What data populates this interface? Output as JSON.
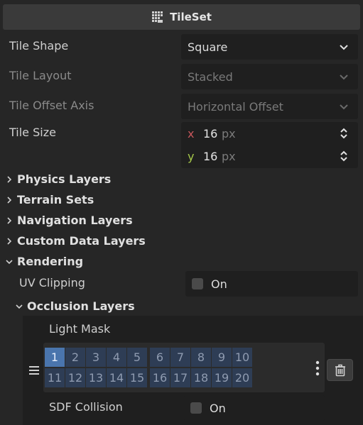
{
  "header": {
    "title": "TileSet",
    "icon": "tileset-icon"
  },
  "properties": {
    "tile_shape": {
      "label": "Tile Shape",
      "value": "Square"
    },
    "tile_layout": {
      "label": "Tile Layout",
      "value": "Stacked"
    },
    "tile_offset_axis": {
      "label": "Tile Offset Axis",
      "value": "Horizontal Offset"
    },
    "tile_size": {
      "label": "Tile Size",
      "x_axis": "x",
      "y_axis": "y",
      "x": "16",
      "y": "16",
      "unit": "px"
    }
  },
  "sections": {
    "physics_layers": "Physics Layers",
    "terrain_sets": "Terrain Sets",
    "navigation_layers": "Navigation Layers",
    "custom_data_layers": "Custom Data Layers",
    "rendering": "Rendering"
  },
  "rendering": {
    "uv_clipping": {
      "label": "UV Clipping",
      "checkbox_label": "On",
      "checked": false
    },
    "occlusion_layers": "Occlusion Layers"
  },
  "occlusion": {
    "light_mask_label": "Light Mask",
    "layers": [
      "1",
      "2",
      "3",
      "4",
      "5",
      "6",
      "7",
      "8",
      "9",
      "10",
      "11",
      "12",
      "13",
      "14",
      "15",
      "16",
      "17",
      "18",
      "19",
      "20"
    ],
    "active_layers": [
      "1"
    ],
    "sdf_collision": {
      "label": "SDF Collision",
      "checkbox_label": "On",
      "checked": false
    }
  },
  "colors": {
    "panel_bg": "#262626",
    "field_bg": "#1f1f1f",
    "accent": "#4a75ad",
    "axis_x": "#c7575b",
    "axis_y": "#a6c94a"
  }
}
